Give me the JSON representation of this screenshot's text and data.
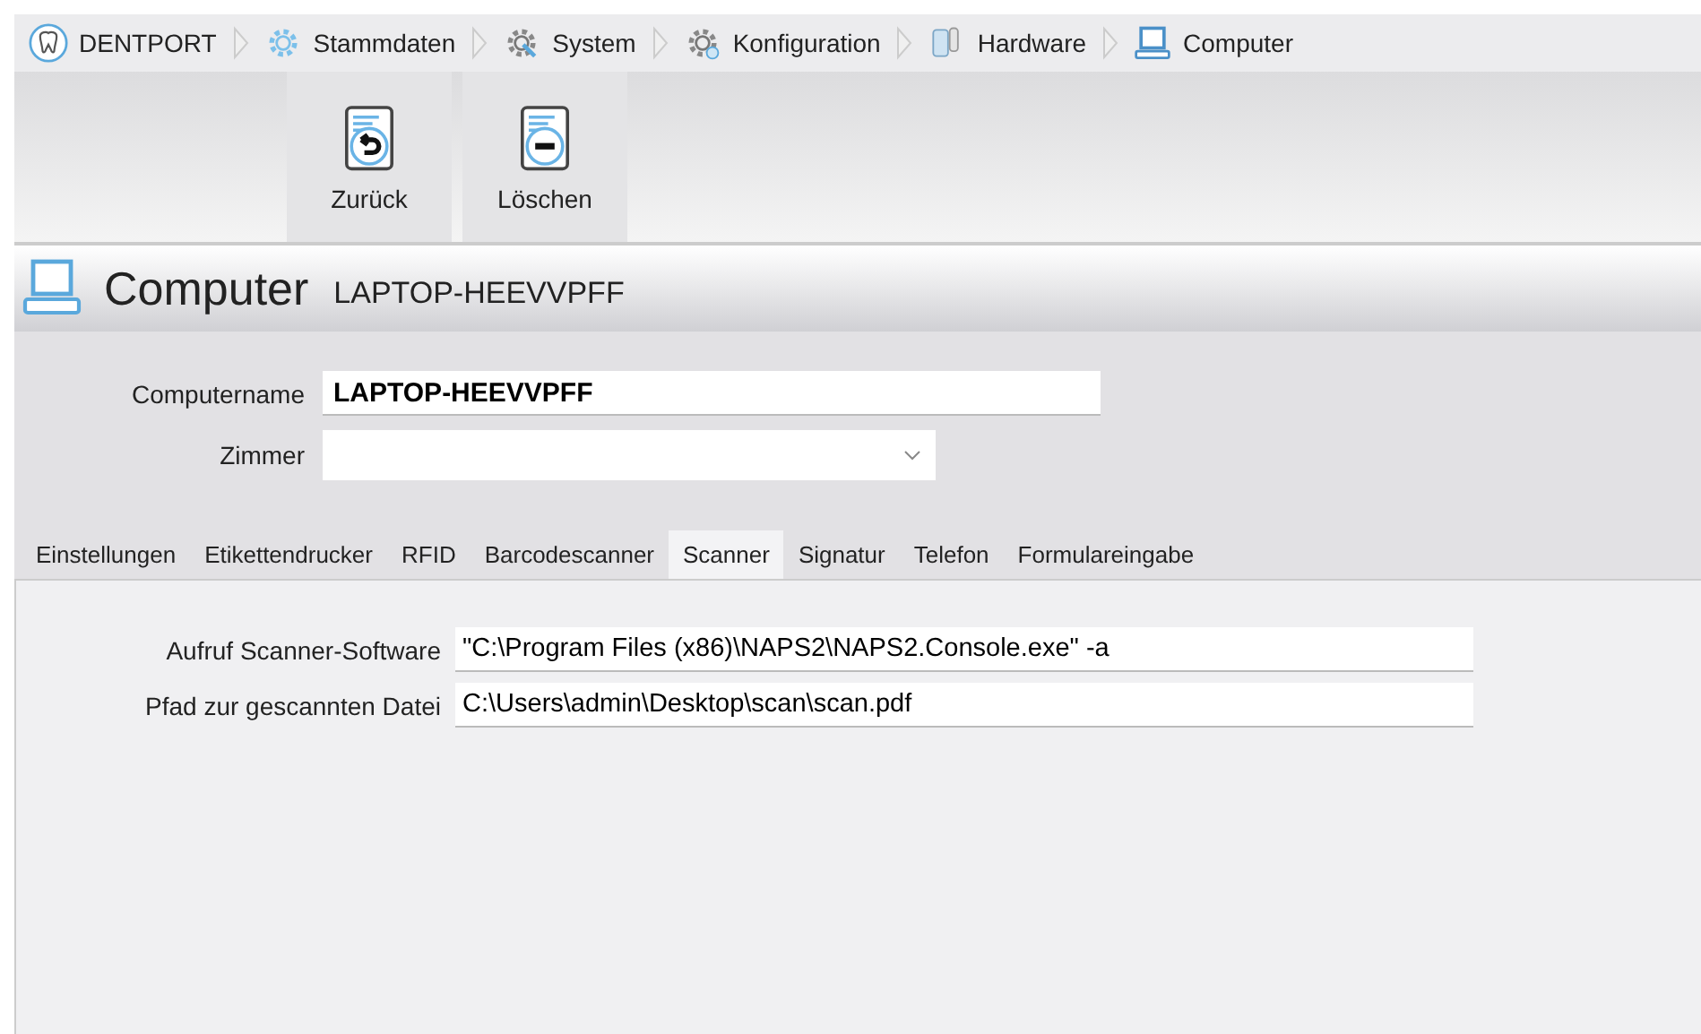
{
  "breadcrumb": [
    {
      "label": "DENTPORT",
      "kind": "tooth"
    },
    {
      "label": "Stammdaten",
      "kind": "gear"
    },
    {
      "label": "System",
      "kind": "wrench-gear"
    },
    {
      "label": "Konfiguration",
      "kind": "gears"
    },
    {
      "label": "Hardware",
      "kind": "hardware"
    },
    {
      "label": "Computer",
      "kind": "computer"
    }
  ],
  "toolbar": [
    {
      "label": "Zurück",
      "kind": "back"
    },
    {
      "label": "Löschen",
      "kind": "delete"
    }
  ],
  "header": {
    "title": "Computer",
    "subtitle": "LAPTOP-HEEVVPFF"
  },
  "form": [
    {
      "label": "Computername",
      "value": "LAPTOP-HEEVVPFF",
      "kind": "text"
    },
    {
      "label": "Zimmer",
      "kind": "select"
    }
  ],
  "tabs": [
    {
      "label": "Einstellungen",
      "selected": false
    },
    {
      "label": "Etikettendrucker",
      "selected": false
    },
    {
      "label": "RFID",
      "selected": false
    },
    {
      "label": "Barcodescanner",
      "selected": false
    },
    {
      "label": "Scanner",
      "selected": true
    },
    {
      "label": "Signatur",
      "selected": false
    },
    {
      "label": "Telefon",
      "selected": false
    },
    {
      "label": "Formulareingabe",
      "selected": false
    }
  ],
  "fields": [
    {
      "label": "Aufruf Scanner-Software",
      "value": "\"C:\\Program Files (x86)\\NAPS2\\NAPS2.Console.exe\" -a"
    },
    {
      "label": "Pfad zur gescannten Datei",
      "value": "C:\\Users\\admin\\Desktop\\scan\\scan.pdf"
    }
  ]
}
